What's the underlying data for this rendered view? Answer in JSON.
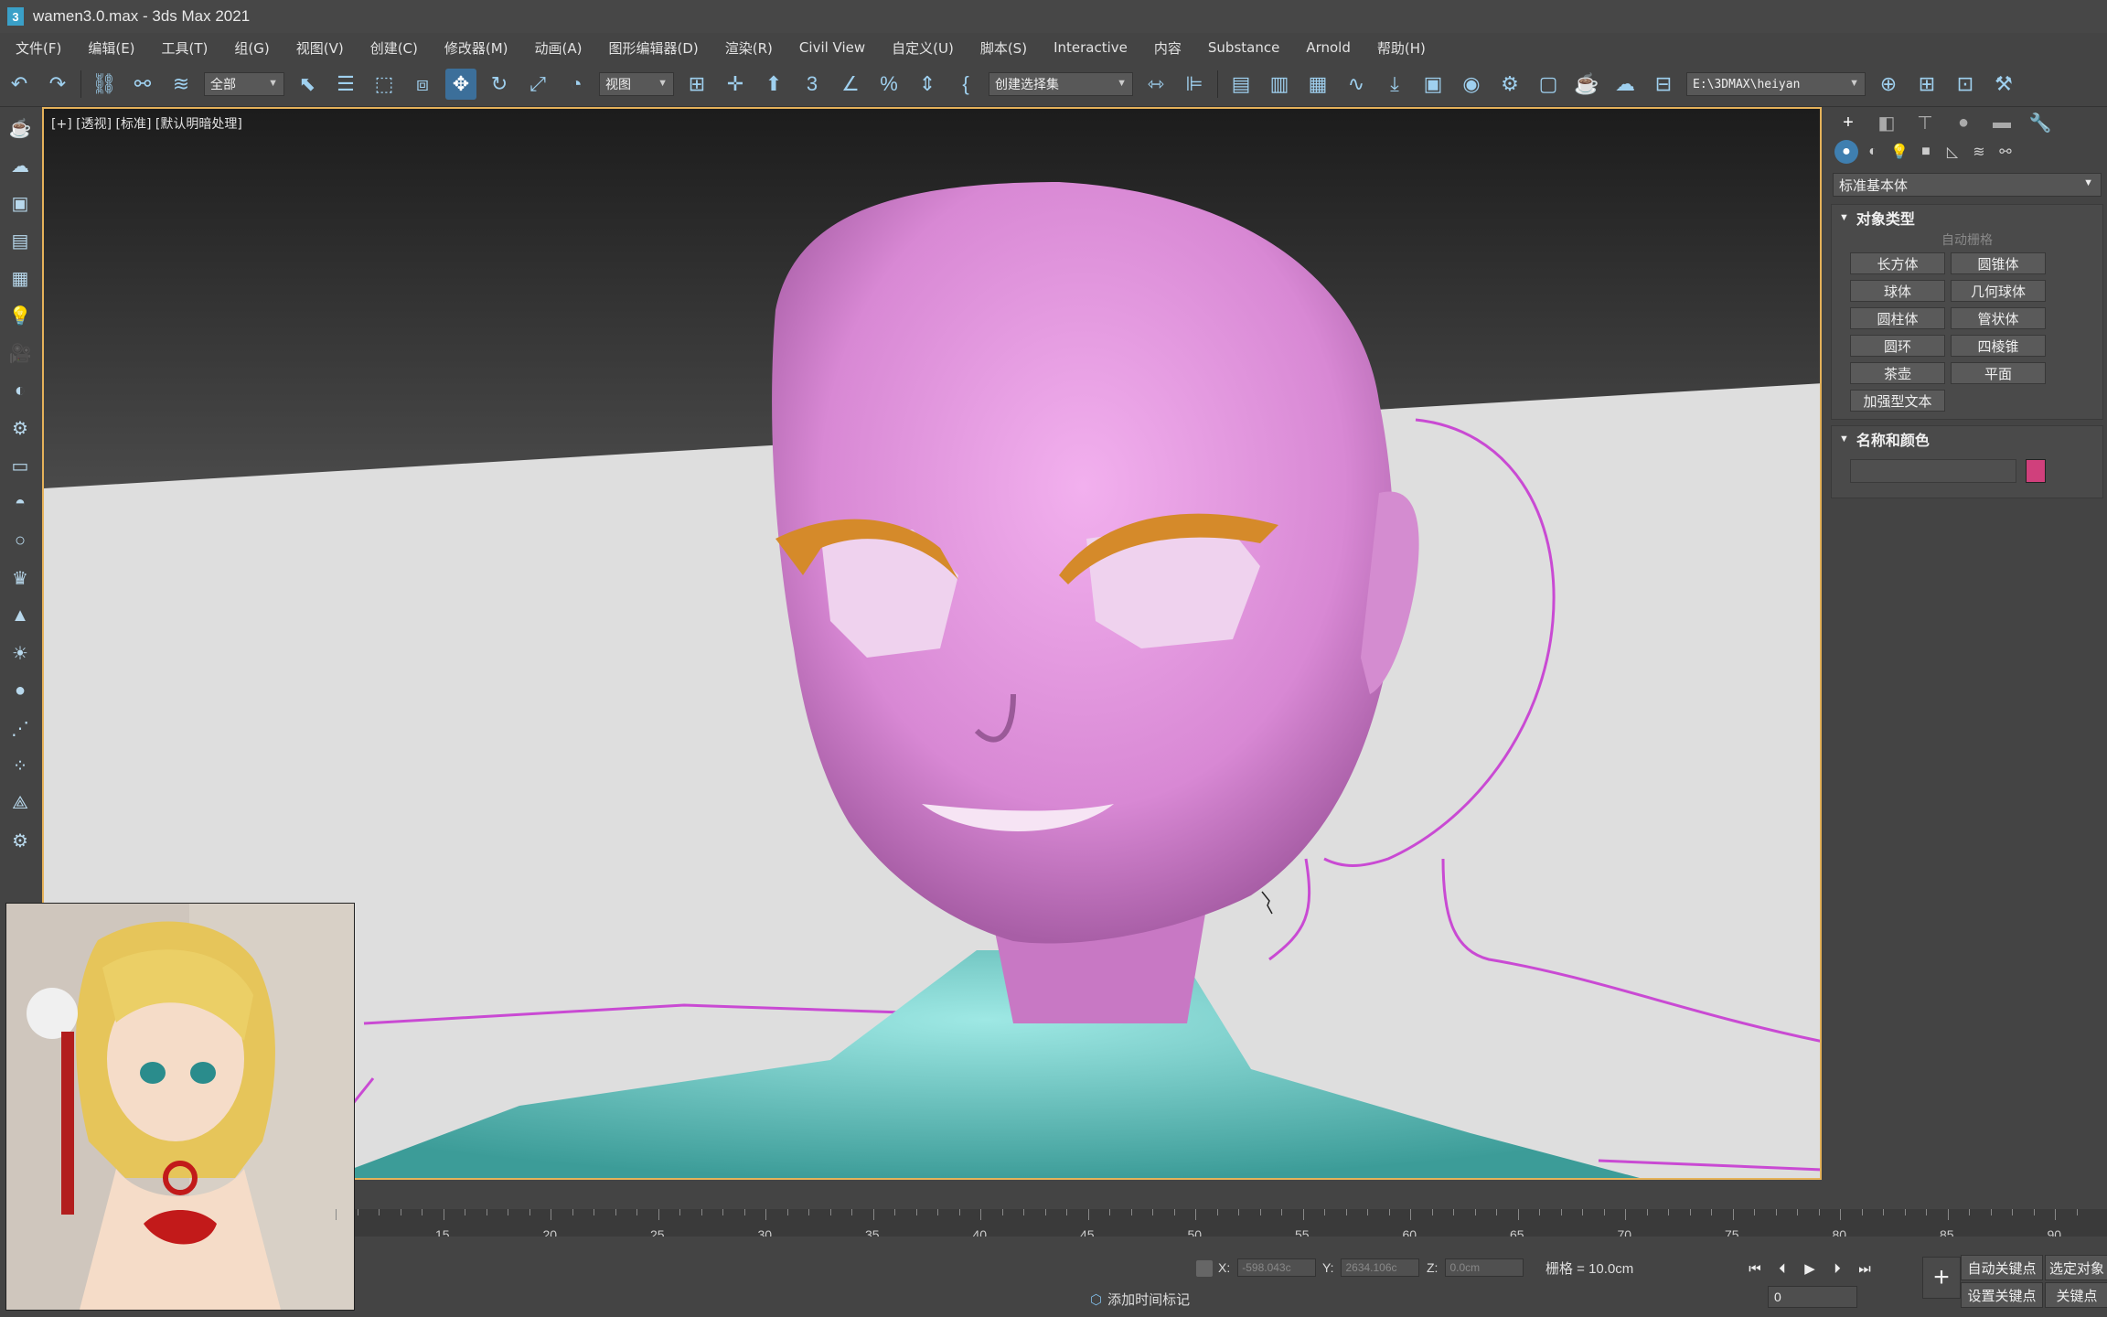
{
  "window": {
    "title": "wamen3.0.max - 3ds Max 2021",
    "icon": "3"
  },
  "menu": [
    "文件(F)",
    "编辑(E)",
    "工具(T)",
    "组(G)",
    "视图(V)",
    "创建(C)",
    "修改器(M)",
    "动画(A)",
    "图形编辑器(D)",
    "渲染(R)",
    "Civil View",
    "自定义(U)",
    "脚本(S)",
    "Interactive",
    "内容",
    "Substance",
    "Arnold",
    "帮助(H)"
  ],
  "toolbar": {
    "filter_select": "全部",
    "ref_coord": "视图",
    "named_selection": "创建选择集",
    "project_path": "E:\\3DMAX\\heiyan"
  },
  "viewport": {
    "label": "[+] [透视] [标准] [默认明暗处理]"
  },
  "command_panel": {
    "category": "标准基本体",
    "object_type_title": "对象类型",
    "autogrid": "自动栅格",
    "buttons": [
      "长方体",
      "圆锥体",
      "球体",
      "几何球体",
      "圆柱体",
      "管状体",
      "圆环",
      "四棱锥",
      "茶壶",
      "平面",
      "加强型文本"
    ],
    "name_color_title": "名称和颜色",
    "object_color": "#d0407c"
  },
  "timeline": {
    "ticks": [
      "15",
      "20",
      "25",
      "30",
      "35",
      "40",
      "45",
      "50",
      "55",
      "60",
      "65",
      "70",
      "75",
      "80",
      "85",
      "90"
    ]
  },
  "status": {
    "x_label": "X:",
    "x_value": "-598.043c",
    "y_label": "Y:",
    "y_value": "2634.106c",
    "z_label": "Z:",
    "z_value": "0.0cm",
    "grid": "栅格 = 10.0cm",
    "add_time_tag": "添加时间标记",
    "auto_key": "自动关键点",
    "selected_object": "选定对象",
    "set_key": "设置关键点",
    "key_filter": "关键点",
    "frame": "0"
  }
}
